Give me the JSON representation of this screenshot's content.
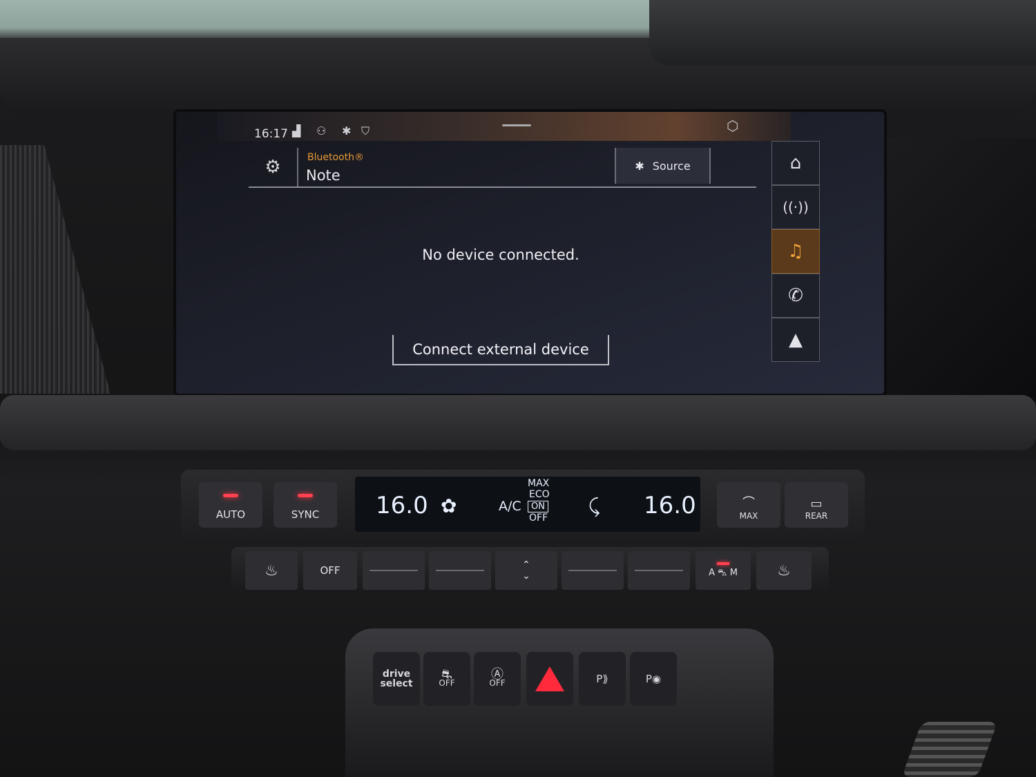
{
  "status_bar": {
    "time": "16:17",
    "icons": [
      "lte-signal-icon",
      "user-icon",
      "bluetooth-icon",
      "privacy-shield-icon"
    ]
  },
  "header": {
    "source_label": "Bluetooth®",
    "device_title": "Note",
    "source_button": "Source"
  },
  "main": {
    "message": "No device connected.",
    "connect_button": "Connect external device"
  },
  "side_nav": [
    {
      "name": "home",
      "icon": "home-icon",
      "active": false
    },
    {
      "name": "radio",
      "icon": "radio-antenna-icon",
      "active": false
    },
    {
      "name": "media",
      "icon": "music-note-icon",
      "active": true
    },
    {
      "name": "phone",
      "icon": "phone-icon",
      "active": false
    },
    {
      "name": "navigation",
      "icon": "navigation-arrow-icon",
      "active": false
    }
  ],
  "climate": {
    "auto_label": "AUTO",
    "sync_label": "SYNC",
    "temp_left": "16.0",
    "temp_right": "16.0",
    "ac_label": "A/C",
    "max_label": "MAX",
    "eco_label": "ECO",
    "on_label": "ON",
    "off_label": "OFF",
    "defrost_max_label": "MAX",
    "rear_label": "REAR",
    "seat_off_label": "OFF",
    "am_a": "A",
    "am_m": "M"
  },
  "console": {
    "drive_select_1": "drive",
    "drive_select_2": "select",
    "esc_off": "OFF",
    "start_stop_off": "OFF",
    "park_label_1": "P",
    "park_label_2": "P"
  },
  "colors": {
    "accent_orange": "#e69a3a",
    "active_nav_bg": "#5a3a1a",
    "led_red": "#ff4150",
    "hazard_red": "#ff2a3c"
  }
}
